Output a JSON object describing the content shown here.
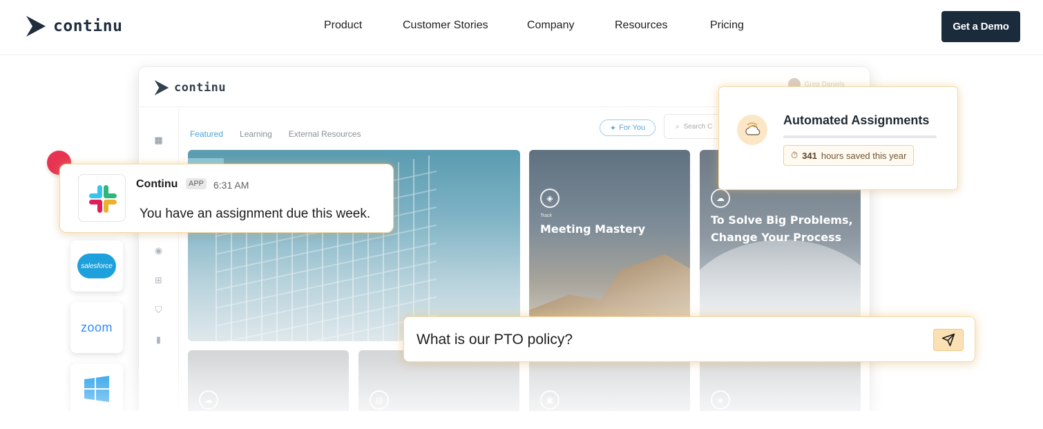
{
  "brand": {
    "name": "continu"
  },
  "nav": {
    "links": [
      "Product",
      "Customer Stories",
      "Company",
      "Resources",
      "Pricing"
    ],
    "cta": "Get a Demo"
  },
  "app": {
    "brand": "continu",
    "user": "Greg Daniels",
    "tabs": [
      "Featured",
      "Learning",
      "External Resources"
    ],
    "for_you": "For You",
    "search_placeholder": "Search C",
    "cards": [
      {
        "kicker": "",
        "title": ""
      },
      {
        "kicker": "Track",
        "title": "Meeting Mastery"
      },
      {
        "kicker": "",
        "title_line1": "To Solve Big Problems,",
        "title_line2": "Change Your Process"
      }
    ]
  },
  "slack": {
    "sender": "Continu",
    "badge": "APP",
    "time": "6:31 AM",
    "message": "You have an assignment due this week."
  },
  "integrations": {
    "salesforce": "salesforce",
    "zoom": "zoom"
  },
  "automated": {
    "title": "Automated Assignments",
    "hours": "341",
    "hours_suffix": "hours saved this year"
  },
  "chat": {
    "question": "What is our PTO policy?"
  },
  "colors": {
    "cta_bg": "#1a2b3c",
    "accent_gold": "#f5d9a8",
    "link_blue": "#4aa3d8",
    "slack_red_dot": "#e73351"
  }
}
